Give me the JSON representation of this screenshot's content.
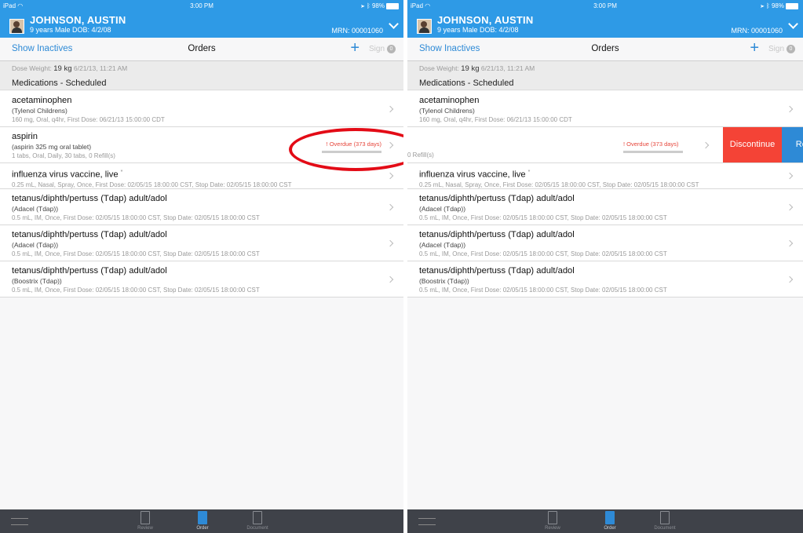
{
  "status": {
    "carrier": "iPad",
    "time": "3:00 PM",
    "battery": "98%"
  },
  "patient": {
    "name": "JOHNSON, AUSTIN",
    "info": "9 years  Male  DOB: 4/2/08",
    "mrn": "MRN: 00001060"
  },
  "nav": {
    "show_inactives": "Show Inactives",
    "title": "Orders",
    "add_label": "+",
    "sign_label": "Sign",
    "sign_count": "0"
  },
  "dose": {
    "label": "Dose Weight:",
    "value": "19 kg",
    "date": "6/21/13, 11:21 AM"
  },
  "section_title": "Medications - Scheduled",
  "orders": [
    {
      "name": "acetaminophen",
      "brand": "(Tylenol Childrens)",
      "detail": "160 mg, Oral, q4hr, First Dose: 06/21/13 15:00:00 CDT"
    },
    {
      "name": "aspirin",
      "brand": "(aspirin 325 mg oral tablet)",
      "detail": "1 tabs, Oral, Daily, 30 tabs, 0 Refill(s)",
      "overdue": "! Overdue (373 days)"
    },
    {
      "name": "influenza virus vaccine, live",
      "mark": "*",
      "detail": "0.25 mL, Nasal, Spray, Once, First Dose: 02/05/15 18:00:00 CST, Stop Date: 02/05/15 18:00:00 CST"
    },
    {
      "name": "tetanus/diphth/pertuss (Tdap) adult/adol",
      "brand": "(Adacel (Tdap))",
      "detail": "0.5 mL, IM, Once, First Dose: 02/05/15 18:00:00 CST, Stop Date: 02/05/15 18:00:00 CST"
    },
    {
      "name": "tetanus/diphth/pertuss (Tdap) adult/adol",
      "brand": "(Adacel (Tdap))",
      "detail": "0.5 mL, IM, Once, First Dose: 02/05/15 18:00:00 CST, Stop Date: 02/05/15 18:00:00 CST"
    },
    {
      "name": "tetanus/diphth/pertuss (Tdap) adult/adol",
      "brand": "(Boostrix (Tdap))",
      "detail": "0.5 mL, IM, Once, First Dose: 02/05/15 18:00:00 CST, Stop Date: 02/05/15 18:00:00 CST"
    }
  ],
  "swipe": {
    "detail_fragment": "0 Refill(s)",
    "discontinue_label": "Discontinue",
    "refill_label": "Refill"
  },
  "tabs": [
    {
      "label": "Review"
    },
    {
      "label": "Order"
    },
    {
      "label": "Document"
    }
  ],
  "colors": {
    "header": "#2e9ae6",
    "accent": "#2e8ad6",
    "overdue": "#e6453a",
    "discontinue": "#f44336",
    "annotation_circle": "#e30b16",
    "tabbar": "#3f4249"
  }
}
